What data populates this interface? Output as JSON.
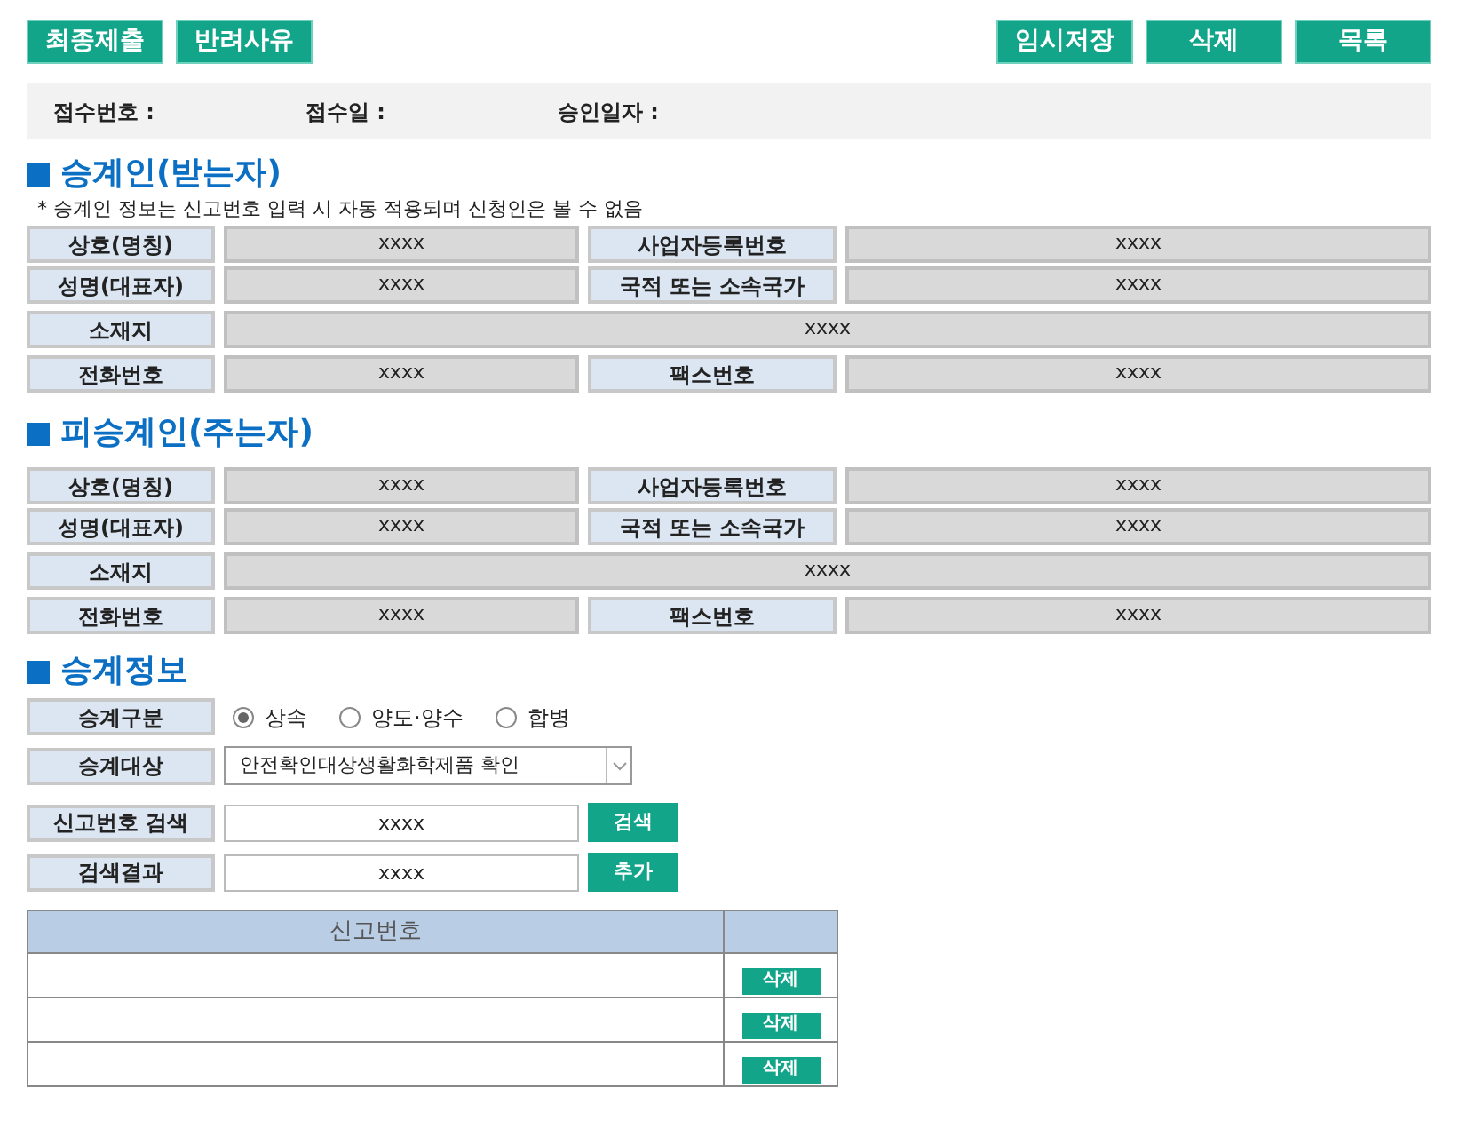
{
  "toolbar": {
    "left_buttons": [
      "최종제출",
      "반려사유"
    ],
    "right_buttons": [
      "임시저장",
      "삭제",
      "목록"
    ]
  },
  "receipt_info": [
    {
      "label": "접수번호 :"
    },
    {
      "label": "접수일 :"
    },
    {
      "label": "승인일자 :"
    }
  ],
  "sections": [
    {
      "title": "승계인(받는자)",
      "note": "* 승계인 정보는 신고번호 입력 시 자동 적용되며 신청인은 볼 수 없음",
      "rows": [
        [
          {
            "label": "상호(명칭)",
            "value": "xxxx"
          },
          {
            "label": "사업자등록번호",
            "value": "xxxx"
          }
        ],
        [
          {
            "label": "성명(대표자)",
            "value": "xxxx"
          },
          {
            "label": "국적 또는 소속국가",
            "value": "xxxx"
          }
        ],
        [
          {
            "label": "소재지",
            "value": "xxxx"
          }
        ],
        [
          {
            "label": "전화번호",
            "value": "xxxx"
          },
          {
            "label": "팩스번호",
            "value": "xxxx"
          }
        ]
      ]
    },
    {
      "title": "피승계인(주는자)",
      "rows": [
        [
          {
            "label": "상호(명칭)",
            "value": "xxxx"
          },
          {
            "label": "사업자등록번호",
            "value": "xxxx"
          }
        ],
        [
          {
            "label": "성명(대표자)",
            "value": "xxxx"
          },
          {
            "label": "국적 또는 소속국가",
            "value": "xxxx"
          }
        ],
        [
          {
            "label": "소재지",
            "value": "xxxx"
          }
        ],
        [
          {
            "label": "전화번호",
            "value": "xxxx"
          },
          {
            "label": "팩스번호",
            "value": "xxxx"
          }
        ]
      ]
    }
  ],
  "succession": {
    "title": "승계정보",
    "type": {
      "label": "승계구분",
      "options": [
        {
          "label": "상속",
          "selected": true
        },
        {
          "label": "양도·양수",
          "selected": false
        },
        {
          "label": "합병",
          "selected": false
        }
      ]
    },
    "target": {
      "label": "승계대상",
      "value": "안전확인대상생활화학제품 확인"
    },
    "search": {
      "label": "신고번호 검색",
      "value": "xxxx",
      "button": "검색"
    },
    "result": {
      "label": "검색결과",
      "value": "xxxx",
      "button": "추가"
    },
    "table": {
      "columns": [
        "신고번호"
      ],
      "rows": [
        {
          "delete": "삭제"
        },
        {
          "delete": "삭제"
        },
        {
          "delete": "삭제"
        }
      ]
    }
  }
}
